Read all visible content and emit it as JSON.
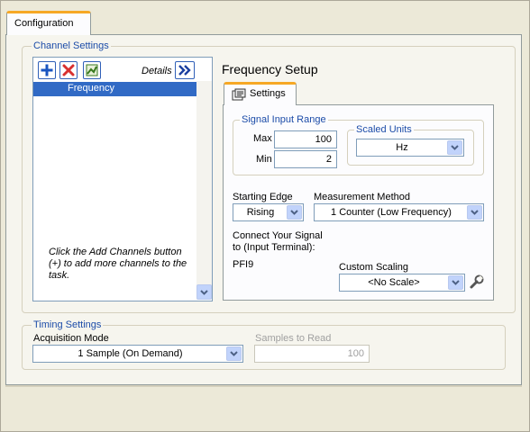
{
  "tabs": {
    "configuration": "Configuration"
  },
  "channel_settings": {
    "title": "Channel Settings",
    "details_label": "Details",
    "channels": [
      "Frequency"
    ],
    "hint": "Click the Add Channels button (+) to add more channels to the task."
  },
  "frequency_setup": {
    "title": "Frequency Setup",
    "settings_tab": "Settings",
    "signal_input_range": {
      "title": "Signal Input Range",
      "max_label": "Max",
      "max_value": "100",
      "min_label": "Min",
      "min_value": "2"
    },
    "scaled_units": {
      "title": "Scaled Units",
      "value": "Hz"
    },
    "starting_edge": {
      "label": "Starting Edge",
      "value": "Rising"
    },
    "measurement_method": {
      "label": "Measurement Method",
      "value": "1 Counter (Low Frequency)"
    },
    "connect_label": "Connect Your Signal to (Input Terminal):",
    "terminal": "PFI9",
    "custom_scaling": {
      "label": "Custom Scaling",
      "value": "<No Scale>"
    }
  },
  "timing_settings": {
    "title": "Timing Settings",
    "acquisition_mode_label": "Acquisition Mode",
    "acquisition_mode_value": "1 Sample (On Demand)",
    "samples_to_read_label": "Samples to Read",
    "samples_to_read_value": "100"
  },
  "colors": {
    "accent_tab": "#f6a825",
    "group_title": "#1c4ca8",
    "selection": "#316ac5",
    "add_icon": "#1a55c0",
    "remove_icon": "#d83030",
    "disabled_text": "#a0a0a0"
  },
  "icons": [
    "plus-icon",
    "remove-x-icon",
    "custom-channel-icon",
    "double-chevron-right-icon",
    "settings-tab-icon",
    "chevron-down-icon",
    "wrench-icon",
    "scroll-down-icon"
  ]
}
